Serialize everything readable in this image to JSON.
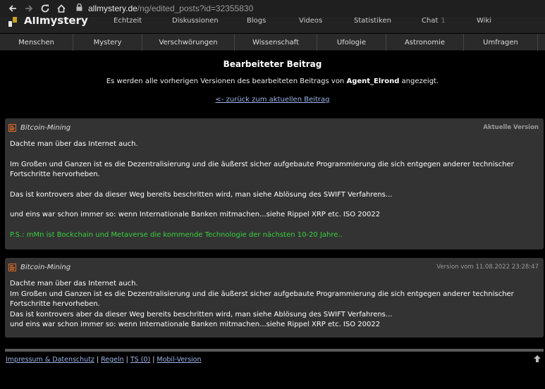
{
  "browser": {
    "url_host": "allmystery.de",
    "url_path": "/ng/edited_posts?id=32355830"
  },
  "site": {
    "logo_text": "Allmystery",
    "top_nav": [
      {
        "label": "Echtzeit"
      },
      {
        "label": "Diskussionen"
      },
      {
        "label": "Blogs"
      },
      {
        "label": "Videos"
      },
      {
        "label": "Statistiken"
      },
      {
        "label": "Chat",
        "count": "1"
      },
      {
        "label": "Wiki"
      }
    ],
    "categories": [
      "Menschen",
      "Mystery",
      "Verschwörungen",
      "Wissenschaft",
      "Ufologie",
      "Astronomie",
      "Umfragen"
    ]
  },
  "page": {
    "title": "Bearbeiteter Beitrag",
    "desc_before": "Es werden alle vorherigen Versionen des bearbeiteten Beitrags von ",
    "desc_user": "Agent_Elrond",
    "desc_after": " angezeigt.",
    "back_link": "<- zurück zum aktuellen Beitrag"
  },
  "posts": [
    {
      "title": "Bitcoin-Mining",
      "meta": "Aktuelle Version",
      "lines": [
        "Dachte man über das Internet auch.",
        "Im Großen und Ganzen ist es die Dezentralisierung und die äußerst sicher aufgebaute Programmierung die sich entgegen anderer technischer Fortschritte hervorheben.",
        "Das ist kontrovers aber da dieser Weg bereits beschritten wird, man siehe Ablösung des SWIFT Verfahrens...",
        "und eins war schon immer so: wenn Internationale Banken mitmachen...siehe Rippel XRP etc. ISO 20022",
        "P.S.: mMn ist Bockchain und Metaverse die kommende Technologie der nächsten 10-20 Jahre.."
      ]
    },
    {
      "title": "Bitcoin-Mining",
      "meta": "Version vom 11.08.2022 23:28:47",
      "lines": [
        "Dachte man über das Internet auch.",
        "Im Großen und Ganzen ist es die Dezentralisierung und die äußerst sicher aufgebaute Programmierung die sich entgegen anderer technischer Fortschritte hervorheben.",
        "Das ist kontrovers aber da dieser Weg bereits beschritten wird, man siehe Ablösung des SWIFT Verfahrens...",
        "und eins war schon immer so: wenn Internationale Banken mitmachen...siehe Rippel XRP etc. ISO 20022"
      ]
    }
  ],
  "footer": {
    "links": [
      "Impressum & Datenschutz",
      "Regeln",
      "TS (0)",
      "Mobil-Version"
    ],
    "separator": "|"
  },
  "colors": {
    "link": "#9bb3e6",
    "green_text": "#39d03f",
    "post_bg": "#333333",
    "logo_accent": "#c9a227"
  },
  "icons": [
    "back-arrow-icon",
    "forward-arrow-icon",
    "reload-icon",
    "home-icon",
    "lock-icon",
    "post-icon",
    "scroll-up-icon"
  ]
}
